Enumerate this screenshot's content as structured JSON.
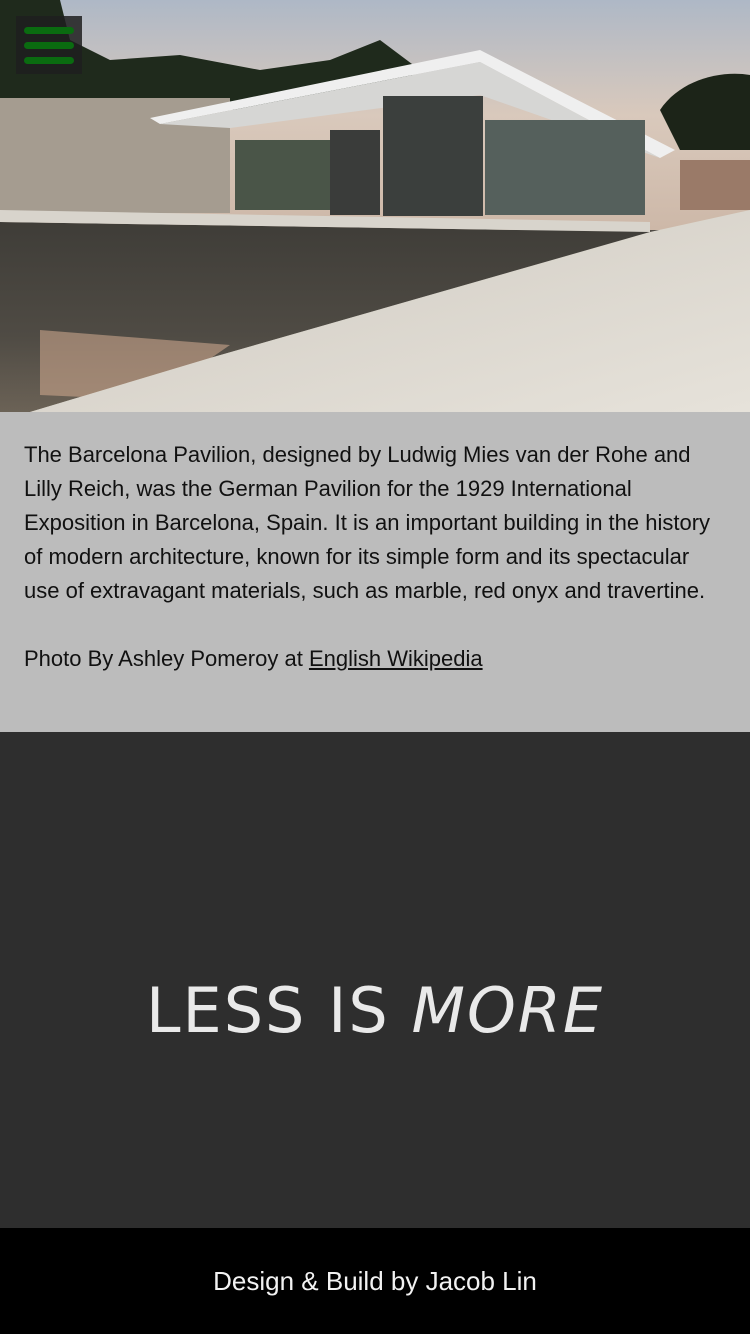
{
  "hero": {
    "image_alt": "Barcelona Pavilion with reflecting pool",
    "menu_icon": "hamburger-menu-icon",
    "menu_color": "#0a6b10"
  },
  "caption": {
    "description": "The Barcelona Pavilion, designed by Ludwig Mies van der Rohe and Lilly Reich, was the German Pavilion for the 1929 International Exposition in Barcelona, Spain. It is an important building in the history of modern architecture, known for its simple form and its spectacular use of extravagant materials, such as marble, red onyx and travertine.",
    "credit_prefix": "Photo By Ashley Pomeroy at ",
    "credit_link": "English Wikipedia"
  },
  "quote": {
    "part1": "LESS IS ",
    "part2": "MORE"
  },
  "footer": {
    "text": "Design & Build by Jacob Lin"
  }
}
